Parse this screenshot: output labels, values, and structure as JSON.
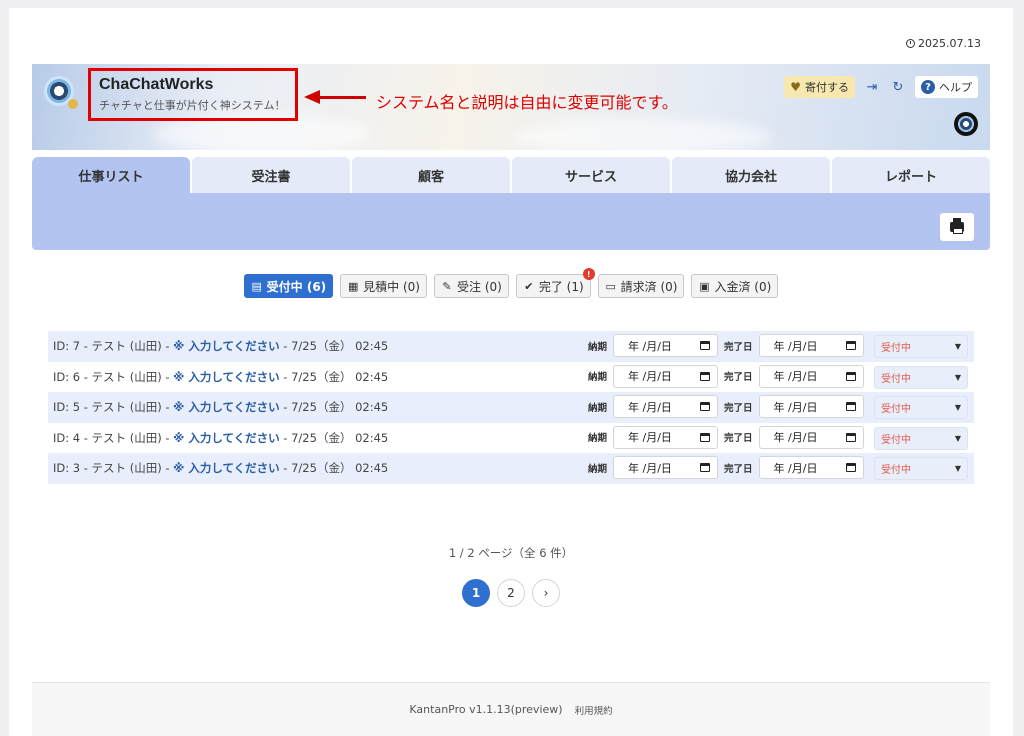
{
  "date": "2025.07.13",
  "header": {
    "app_name": "ChaChatWorks",
    "app_desc": "チャチャと仕事が片付く神システム！",
    "annotation": "システム名と説明は自由に変更可能です。",
    "donate_label": "寄付する",
    "help_label": "ヘルプ"
  },
  "tabs": [
    {
      "label": "仕事リスト",
      "active": true
    },
    {
      "label": "受注書"
    },
    {
      "label": "顧客"
    },
    {
      "label": "サービス"
    },
    {
      "label": "協力会社"
    },
    {
      "label": "レポート"
    }
  ],
  "filters": [
    {
      "label": "受付中 (6)",
      "icon": "list-icon",
      "active": true
    },
    {
      "label": "見積中 (0)",
      "icon": "calculator-icon"
    },
    {
      "label": "受注 (0)",
      "icon": "wrench-icon"
    },
    {
      "label": "完了 (1)",
      "icon": "check-circle-icon",
      "badge": "!"
    },
    {
      "label": "請求済 (0)",
      "icon": "credit-card-icon"
    },
    {
      "label": "入金済 (0)",
      "icon": "wallet-icon"
    }
  ],
  "rows": [
    {
      "prefix": "ID: 7 - テスト (山田) - ",
      "highlight": "※ 入力してください",
      "suffix": " - 7/25（金） 02:45"
    },
    {
      "prefix": "ID: 6 - テスト (山田) - ",
      "highlight": "※ 入力してください",
      "suffix": " - 7/25（金） 02:45"
    },
    {
      "prefix": "ID: 5 - テスト (山田) - ",
      "highlight": "※ 入力してください",
      "suffix": " - 7/25（金） 02:45"
    },
    {
      "prefix": "ID: 4 - テスト (山田) - ",
      "highlight": "※ 入力してください",
      "suffix": " - 7/25（金） 02:45"
    },
    {
      "prefix": "ID: 3 - テスト (山田) - ",
      "highlight": "※ 入力してください",
      "suffix": " - 7/25（金） 02:45"
    }
  ],
  "row_fields": {
    "due_label": "納期",
    "done_label": "完了日",
    "date_placeholder": "年 /月/日",
    "status_value": "受付中"
  },
  "pagination": {
    "info": "1 / 2 ページ（全 6 件）",
    "pages": [
      "1",
      "2",
      "›"
    ],
    "current": "1"
  },
  "footer": {
    "version": "KantanPro v1.1.13(preview)",
    "terms": "利用規約"
  },
  "colors": {
    "accent": "#2f6fd0",
    "tab_active": "#b3c4f0",
    "annotation": "#e00000",
    "status_text": "#e05b4b"
  }
}
